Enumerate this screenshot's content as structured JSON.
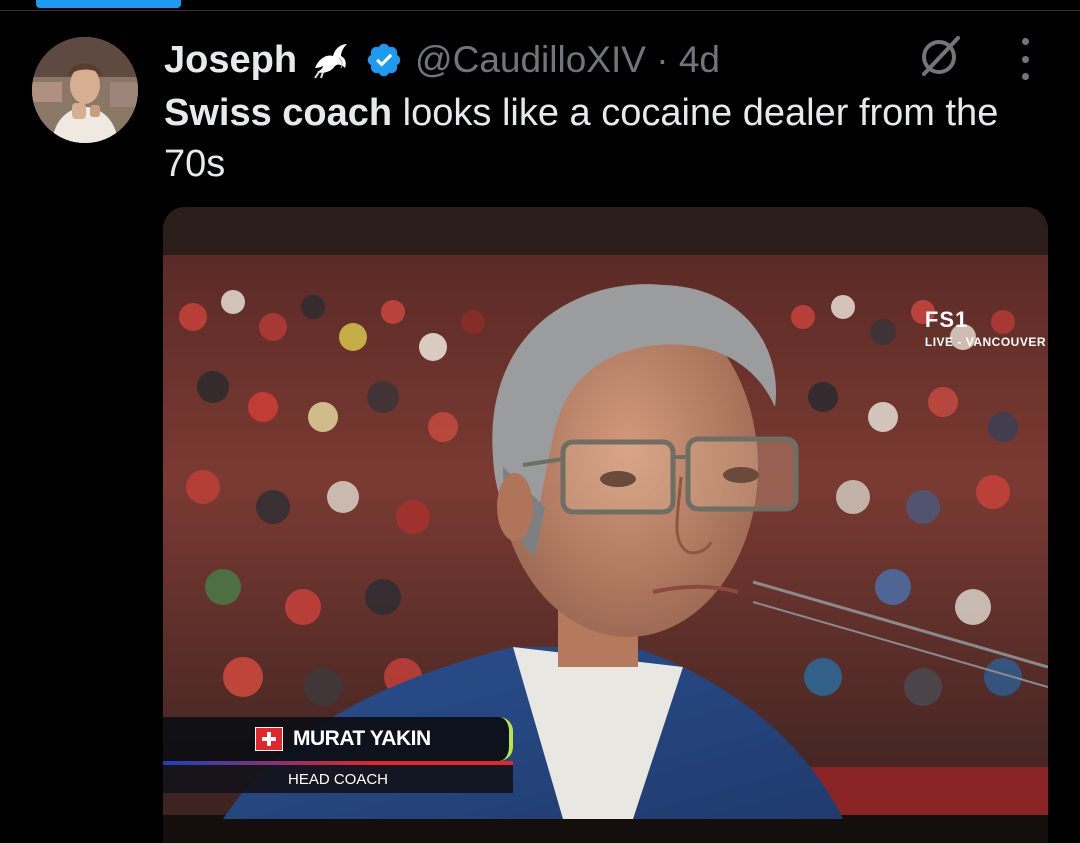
{
  "tweet": {
    "display_name": "Joseph",
    "handle": "@CaudilloXIV",
    "separator": "·",
    "time_ago": "4d",
    "text_bold": "Swiss coach",
    "text_rest": " looks like a cocaine dealer from the 70s"
  },
  "media": {
    "broadcaster_logo": "FS1",
    "broadcast_location": "LIVE - VANCOUVER",
    "lower_third_name": "MURAT YAKIN",
    "lower_third_role": "HEAD COACH"
  },
  "icons": {
    "verified": "verified-badge-icon",
    "dove": "dove-icon",
    "grok": "grok-icon",
    "more": "more-vertical-icon",
    "flag": "swiss-flag-icon"
  },
  "colors": {
    "background": "#000000",
    "accent": "#1d9bf0",
    "text_primary": "#e7e9ea",
    "text_secondary": "#71767b",
    "lower_third_accent": "#b6e64a"
  }
}
